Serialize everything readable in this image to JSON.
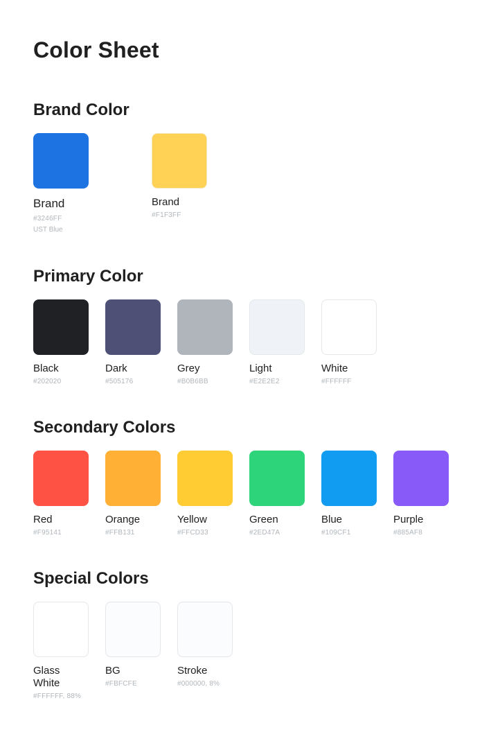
{
  "title": "Color Sheet",
  "brand": {
    "title": "Brand Color",
    "swatches": [
      {
        "label": "Brand",
        "hex": "#3246FF",
        "sub": "UST Blue",
        "color": "#1E73E2"
      },
      {
        "label": "Brand",
        "hex": "#F1F3FF",
        "color": "#FFD155"
      }
    ]
  },
  "primary": {
    "title": "Primary Color",
    "swatches": [
      {
        "label": "Black",
        "hex": "#202020",
        "color": "#202124"
      },
      {
        "label": "Dark",
        "hex": "#505176",
        "color": "#4E5076"
      },
      {
        "label": "Grey",
        "hex": "#B0B6BB",
        "color": "#B0B5BB"
      },
      {
        "label": "Light",
        "hex": "#E2E2E2",
        "color": "#EFF2F6"
      },
      {
        "label": "White",
        "hex": "#FFFFFF",
        "color": "#FFFFFF"
      }
    ]
  },
  "secondary": {
    "title": "Secondary Colors",
    "swatches": [
      {
        "label": "Red",
        "hex": "#F95141",
        "color": "#FD5244"
      },
      {
        "label": "Orange",
        "hex": "#FFB131",
        "color": "#FFB035"
      },
      {
        "label": "Yellow",
        "hex": "#FFCD33",
        "color": "#FFCD33"
      },
      {
        "label": "Green",
        "hex": "#2ED47A",
        "color": "#2ED47A"
      },
      {
        "label": "Blue",
        "hex": "#109CF1",
        "color": "#129CF1"
      },
      {
        "label": "Purple",
        "hex": "#885AF8",
        "color": "#885AF8"
      }
    ]
  },
  "special": {
    "title": "Special Colors",
    "swatches": [
      {
        "label": "Glass White",
        "hex": "#FFFFFF, 88%",
        "color": "#FFFFFF"
      },
      {
        "label": "BG",
        "hex": "#FBFCFE",
        "color": "#FBFCFE"
      },
      {
        "label": "Stroke",
        "hex": "#000000, 8%",
        "color": "#FBFCFE"
      }
    ]
  }
}
